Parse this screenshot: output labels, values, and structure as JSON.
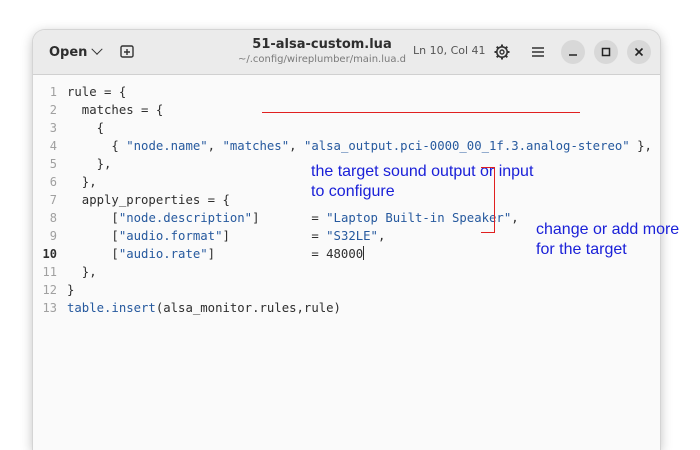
{
  "toolbar": {
    "open_label": "Open",
    "new_tab_icon": "new-tab-icon"
  },
  "header": {
    "title": "51-alsa-custom.lua",
    "subtitle": "~/.config/wireplumber/main.lua.d",
    "position": "Ln 10, Col 41"
  },
  "editor": {
    "current_line": 10,
    "line_numbers": [
      "1",
      "2",
      "3",
      "4",
      "5",
      "6",
      "7",
      "8",
      "9",
      "10",
      "11",
      "12",
      "13"
    ],
    "lines": [
      [
        {
          "t": "rule = {"
        }
      ],
      [
        {
          "t": "  matches = {"
        }
      ],
      [
        {
          "t": "    {"
        }
      ],
      [
        {
          "t": "      { "
        },
        {
          "t": "\"node.name\"",
          "c": "str"
        },
        {
          "t": ", "
        },
        {
          "t": "\"matches\"",
          "c": "str"
        },
        {
          "t": ", "
        },
        {
          "t": "\"alsa_output.pci-0000_00_1f.3.analog-stereo\"",
          "c": "str"
        },
        {
          "t": " },"
        }
      ],
      [
        {
          "t": "    },"
        }
      ],
      [
        {
          "t": "  },"
        }
      ],
      [
        {
          "t": "  apply_properties = {"
        }
      ],
      [
        {
          "t": "      ["
        },
        {
          "t": "\"node.description\"",
          "c": "str"
        },
        {
          "t": "]       = "
        },
        {
          "t": "\"Laptop Built-in Speaker\"",
          "c": "str"
        },
        {
          "t": ","
        }
      ],
      [
        {
          "t": "      ["
        },
        {
          "t": "\"audio.format\"",
          "c": "str"
        },
        {
          "t": "]           = "
        },
        {
          "t": "\"S32LE\"",
          "c": "str"
        },
        {
          "t": ","
        }
      ],
      [
        {
          "t": "      ["
        },
        {
          "t": "\"audio.rate\"",
          "c": "str"
        },
        {
          "t": "]             = 48000"
        },
        {
          "t": "",
          "c": "caret"
        }
      ],
      [
        {
          "t": "  },"
        }
      ],
      [
        {
          "t": "}"
        }
      ],
      [
        {
          "t": "table.insert",
          "c": "kw"
        },
        {
          "t": "(alsa_monitor.rules,rule)"
        }
      ]
    ]
  },
  "annotations": {
    "target_line1": "the target sound output or input",
    "target_line2": "to configure",
    "change_line1": "change or add more",
    "change_line2": "for the target",
    "color": "#1a20d8",
    "marker_color": "#e02020"
  }
}
